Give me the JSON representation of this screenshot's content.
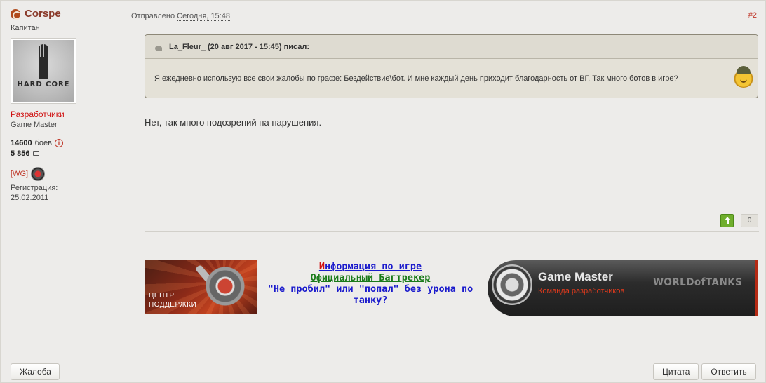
{
  "author": {
    "name": "Corspe",
    "rank": "Капитан",
    "avatar_text": "HARD CORE",
    "group": "Разработчики",
    "title": "Game Master",
    "battles_value": "14600",
    "battles_label": "боев",
    "posts_value": "5 856",
    "clan_tag": "[WG]",
    "registration_label": "Регистрация:",
    "registration_date": "25.02.2011"
  },
  "post": {
    "posted_label": "Отправлено",
    "posted_date": "Сегодня, 15:48",
    "number": "#2",
    "quote_header": "La_Fleur_ (20 авг 2017 - 15:45) писал:",
    "quote_text": "Я ежедневно использую все свои жалобы по графе: Бездействие\\бот. И мне каждый день приходит благодарность от ВГ. Так много ботов в игре?",
    "text": "Нет, так много подозрений на нарушения.",
    "reputation": "0"
  },
  "signature": {
    "support_banner": "ЦЕНТР ПОДДЕРЖКИ",
    "link_info_first": "И",
    "link_info_rest": "нформация по игре",
    "link_bugtracker": "Официальный Багтрекер",
    "link_nopen": "\"Не пробил\" или \"попал\" без урона по танку?",
    "gm_title": "Game Master",
    "gm_subtitle": "Команда разработчиков",
    "gm_wot": "WORLDofTANKS"
  },
  "buttons": {
    "report": "Жалоба",
    "quote": "Цитата",
    "reply": "Ответить"
  },
  "icons": {
    "online": "online-status-icon",
    "info": "info-icon",
    "posts": "comment-icon",
    "clan": "clan-emblem-icon",
    "quote": "quote-icon",
    "smiley": "tank-smiley-icon",
    "rep_up": "thumb-up-arrow-icon"
  },
  "colors": {
    "background": "#edecea",
    "author_name": "#8a3a2a",
    "group": "#d01010",
    "post_number": "#c0392b",
    "rep_up": "#6fae2c"
  }
}
